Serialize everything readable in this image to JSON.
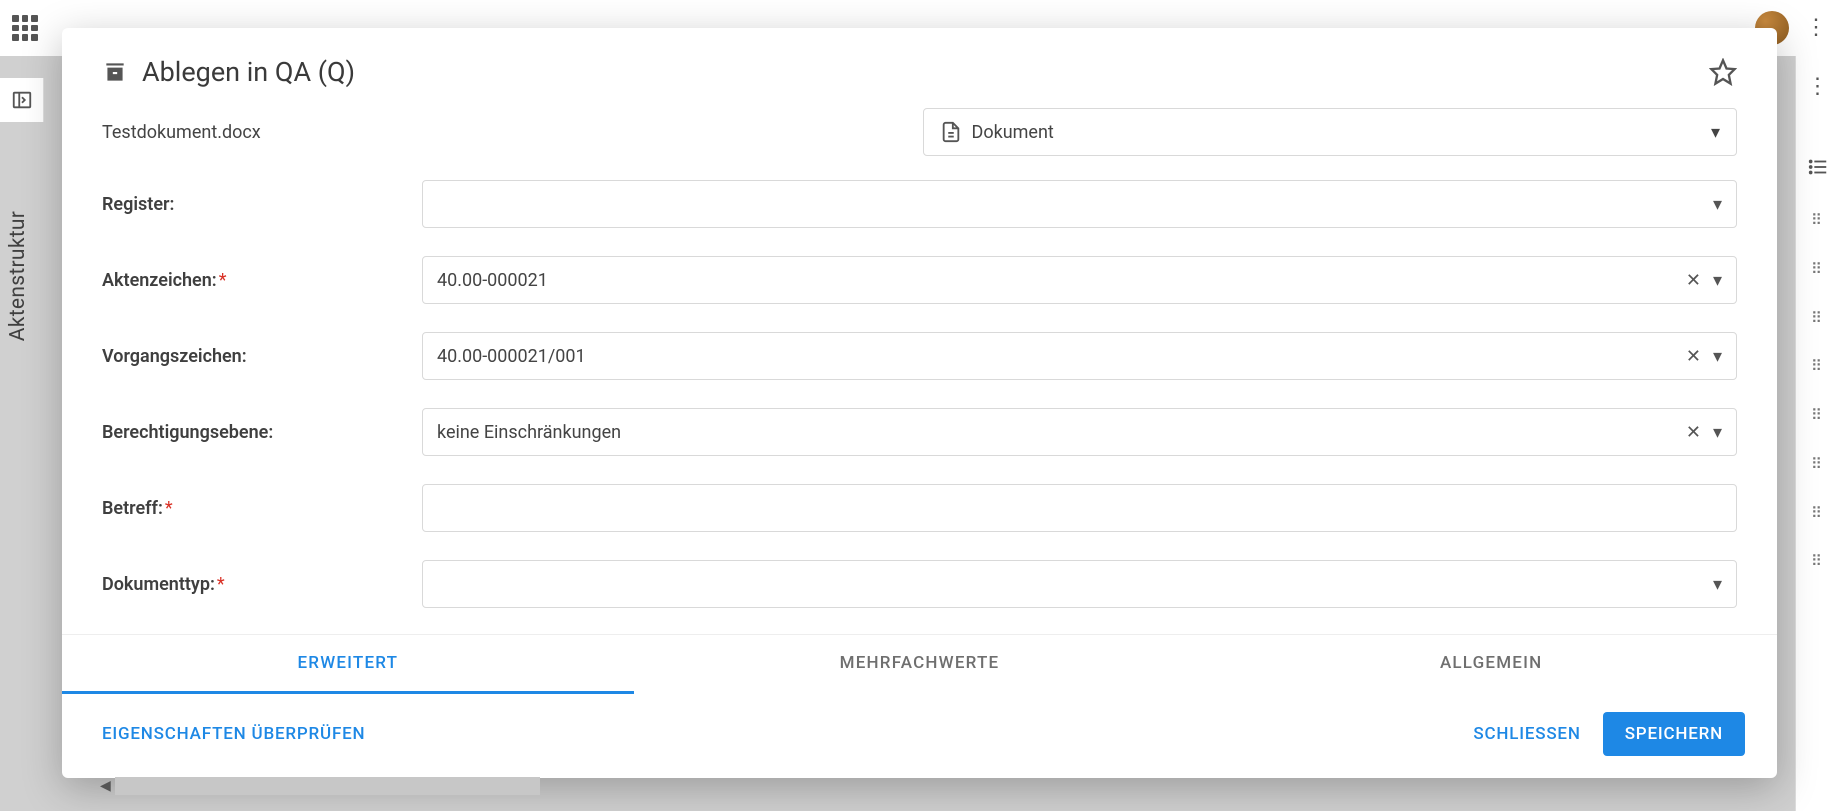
{
  "sidebar_label": "Aktenstruktur",
  "modal": {
    "title": "Ablegen in QA (Q)",
    "document_name": "Testdokument.docx",
    "type_label": "Dokument",
    "fields": {
      "register_label": "Register:",
      "register_value": "",
      "aktenzeichen_label": "Aktenzeichen:",
      "aktenzeichen_value": "40.00-000021",
      "vorgangszeichen_label": "Vorgangszeichen:",
      "vorgangszeichen_value": "40.00-000021/001",
      "berechtigung_label": "Berechtigungsebene:",
      "berechtigung_value": "keine Einschränkungen",
      "betreff_label": "Betreff:",
      "betreff_value": "",
      "dokumenttyp_label": "Dokumenttyp:",
      "dokumenttyp_value": ""
    },
    "tabs": {
      "erweitert": "ERWEITERT",
      "mehrfachwerte": "MEHRFACHWERTE",
      "allgemein": "ALLGEMEIN"
    },
    "footer": {
      "check_props": "EIGENSCHAFTEN ÜBERPRÜFEN",
      "close": "SCHLIESSEN",
      "save": "SPEICHERN"
    }
  }
}
